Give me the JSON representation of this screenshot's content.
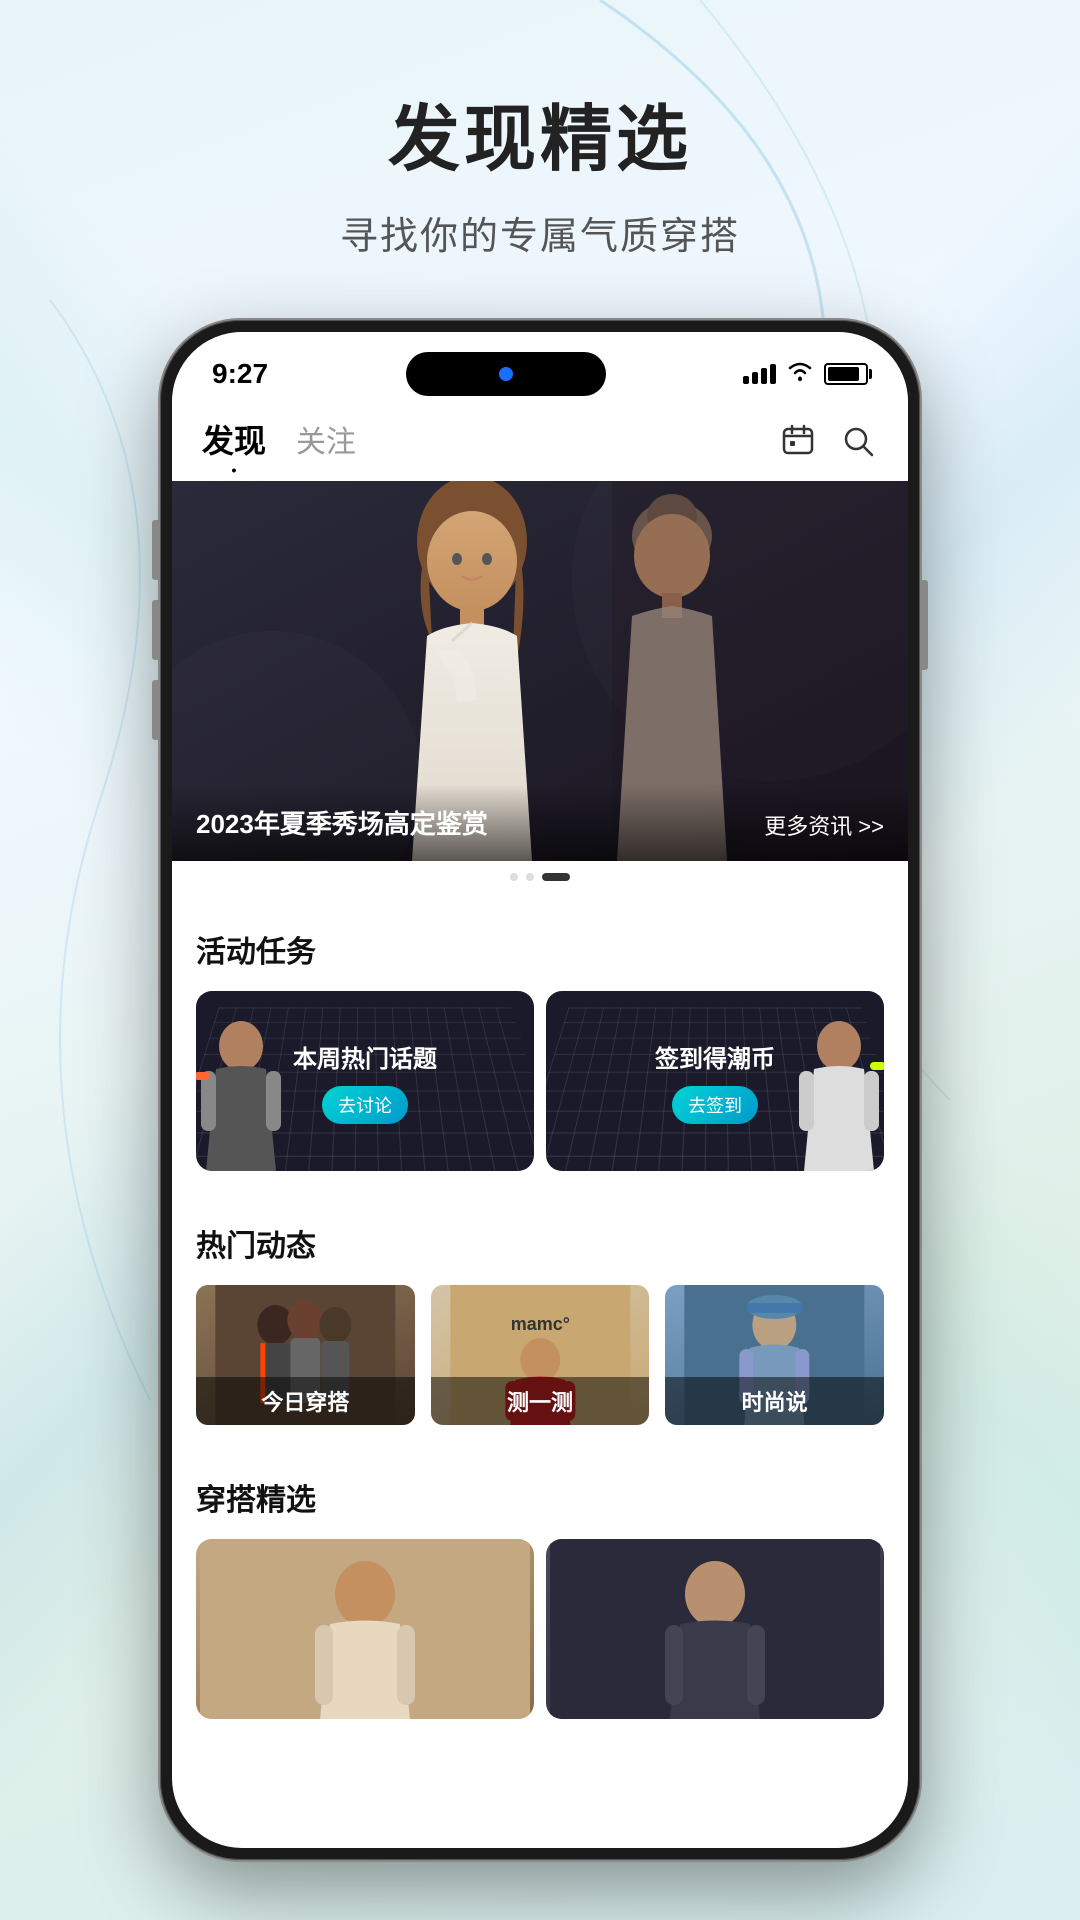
{
  "page": {
    "title": "发现精选",
    "subtitle": "寻找你的专属气质穿搭",
    "bg_colors": {
      "primary": "#e8f4f8",
      "secondary": "#e0f0e8",
      "accent": "#00d4d4"
    }
  },
  "status_bar": {
    "time": "9:27",
    "signal_level": 4,
    "wifi": true,
    "battery": 85
  },
  "nav": {
    "tabs": [
      {
        "id": "discover",
        "label": "发现",
        "active": true
      },
      {
        "id": "follow",
        "label": "关注",
        "active": false
      }
    ],
    "icons": [
      {
        "id": "calendar",
        "label": "日历"
      },
      {
        "id": "search",
        "label": "搜索"
      }
    ]
  },
  "hero_banner": {
    "title": "2023年夏季秀场高定鉴赏",
    "more_text": "更多资讯 >>",
    "dots": [
      {
        "active": false
      },
      {
        "active": false
      },
      {
        "active": true
      }
    ]
  },
  "sections": {
    "activities": {
      "title": "活动任务",
      "cards": [
        {
          "id": "hot-topic",
          "text": "本周热门话题",
          "btn_label": "去讨论",
          "model_color": "#ff6633"
        },
        {
          "id": "checkin",
          "text": "签到得潮币",
          "btn_label": "去签到",
          "model_color": "#ccff00"
        }
      ]
    },
    "hot_trends": {
      "title": "热门动态",
      "items": [
        {
          "id": "outfit",
          "label": "今日穿搭",
          "bg_type": "outfit"
        },
        {
          "id": "test",
          "label": "测一测",
          "bg_type": "mamc",
          "brand": "mamc°"
        },
        {
          "id": "fashion",
          "label": "时尚说",
          "bg_type": "fashion"
        }
      ]
    },
    "curation": {
      "title": "穿搭精选",
      "cards": [
        {
          "id": "curation-1",
          "bg_type": "1"
        },
        {
          "id": "curation-2",
          "bg_type": "2"
        }
      ]
    }
  }
}
